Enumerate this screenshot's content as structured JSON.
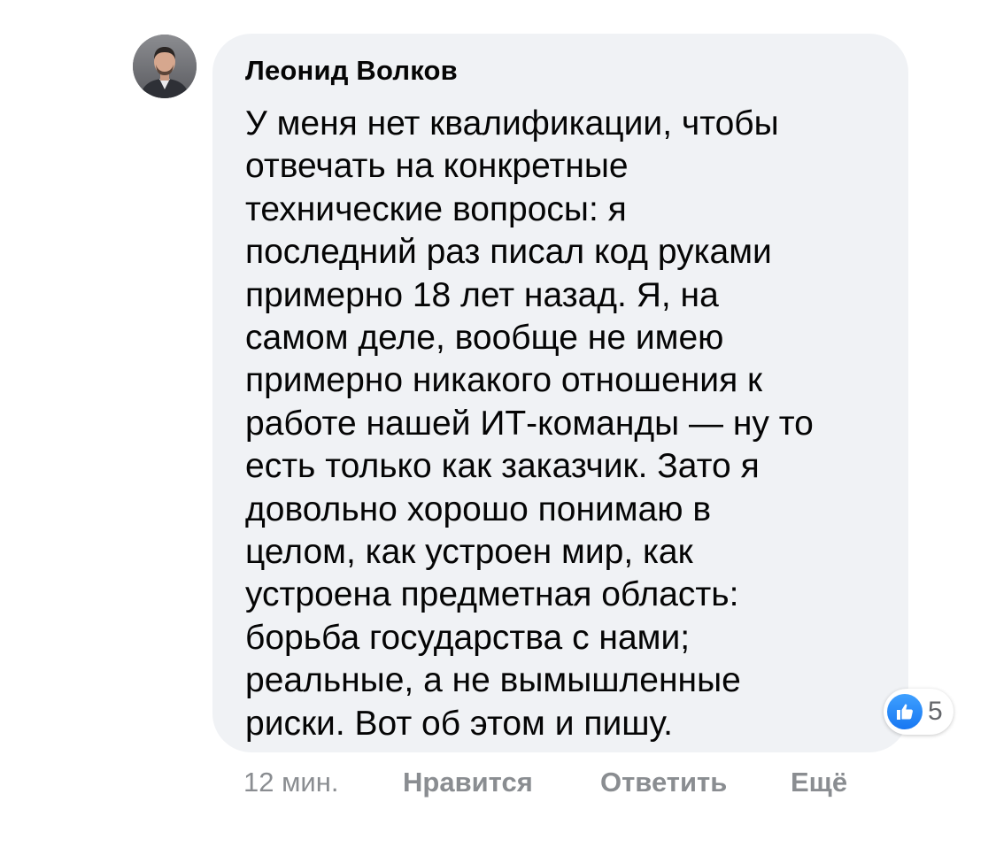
{
  "comment": {
    "author": "Леонид Волков",
    "text_lines": [
      "У меня нет квалификации, чтобы",
      "отвечать на конкретные",
      "технические вопросы: я",
      "последний раз писал код руками",
      "примерно 18 лет назад. Я, на",
      "самом деле, вообще не имею",
      "примерно никакого отношения к",
      "работе нашей ИТ-команды — ну то",
      "есть только как заказчик. Зато я",
      "довольно хорошо понимаю в",
      "целом, как устроен мир, как",
      "устроена предметная область:",
      "борьба государства с нами;",
      "реальные, а не вымышленные",
      "риски. Вот об этом и пишу."
    ],
    "reactions": {
      "icon": "like-icon",
      "count": "5"
    }
  },
  "actions": {
    "time": "12 мин.",
    "like_label": "Нравится",
    "reply_label": "Ответить",
    "more_label": "Ещё"
  },
  "colors": {
    "bubble": "#f0f2f5",
    "text": "#050505",
    "meta": "#8a8d91",
    "like_blue": "#1877f2"
  }
}
